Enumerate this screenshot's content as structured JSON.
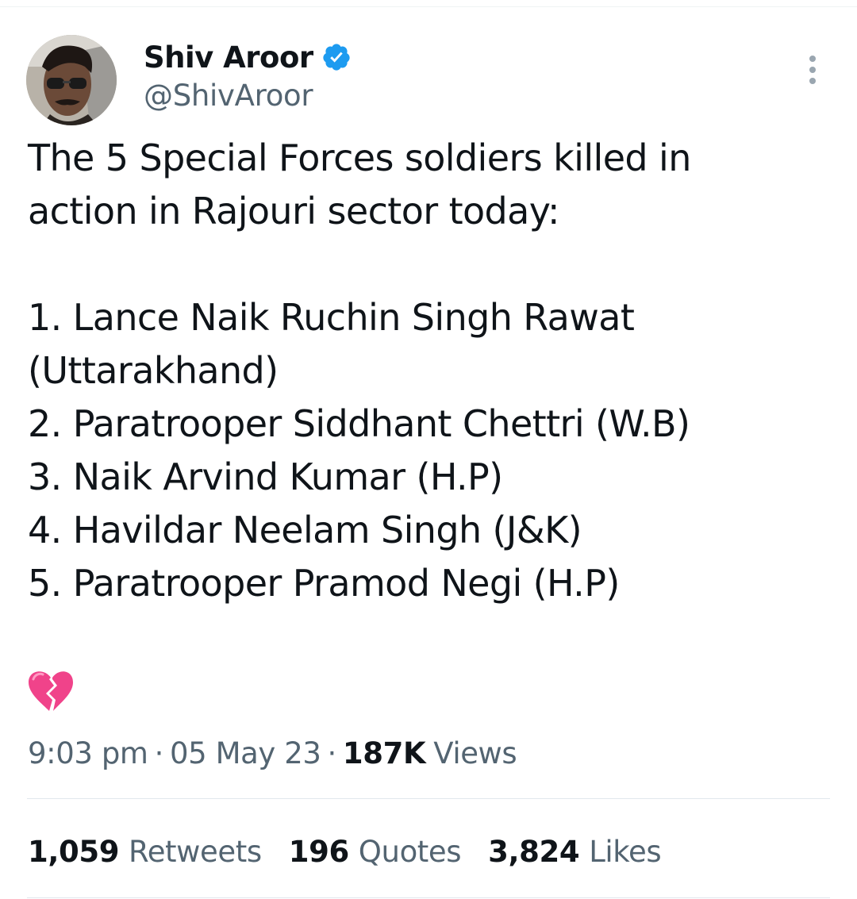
{
  "author": {
    "display_name": "Shiv Aroor",
    "handle": "@ShivAroor",
    "verified": true
  },
  "tweet": {
    "lines": [
      "The 5 Special Forces soldiers killed in",
      "action in Rajouri sector today:",
      "",
      "1. Lance Naik Ruchin Singh Rawat",
      "(Uttarakhand)",
      "2. Paratrooper Siddhant Chettri (W.B)",
      "3. Naik Arvind Kumar (H.P)",
      "4. Havildar Neelam Singh (J&K)",
      "5. Paratrooper Pramod Negi (H.P)",
      ""
    ],
    "emoji": "broken-heart",
    "time": "9:03 pm",
    "date": "05 May 23",
    "views_count": "187K",
    "views_label": "Views",
    "separator": "·"
  },
  "stats": {
    "retweets_count": "1,059",
    "retweets_label": "Retweets",
    "quotes_count": "196",
    "quotes_label": "Quotes",
    "likes_count": "3,824",
    "likes_label": "Likes"
  },
  "colors": {
    "primary_text": "#0f1419",
    "secondary_text": "#536471",
    "verified_blue": "#1d9bf0",
    "divider": "#e1e8ed"
  }
}
